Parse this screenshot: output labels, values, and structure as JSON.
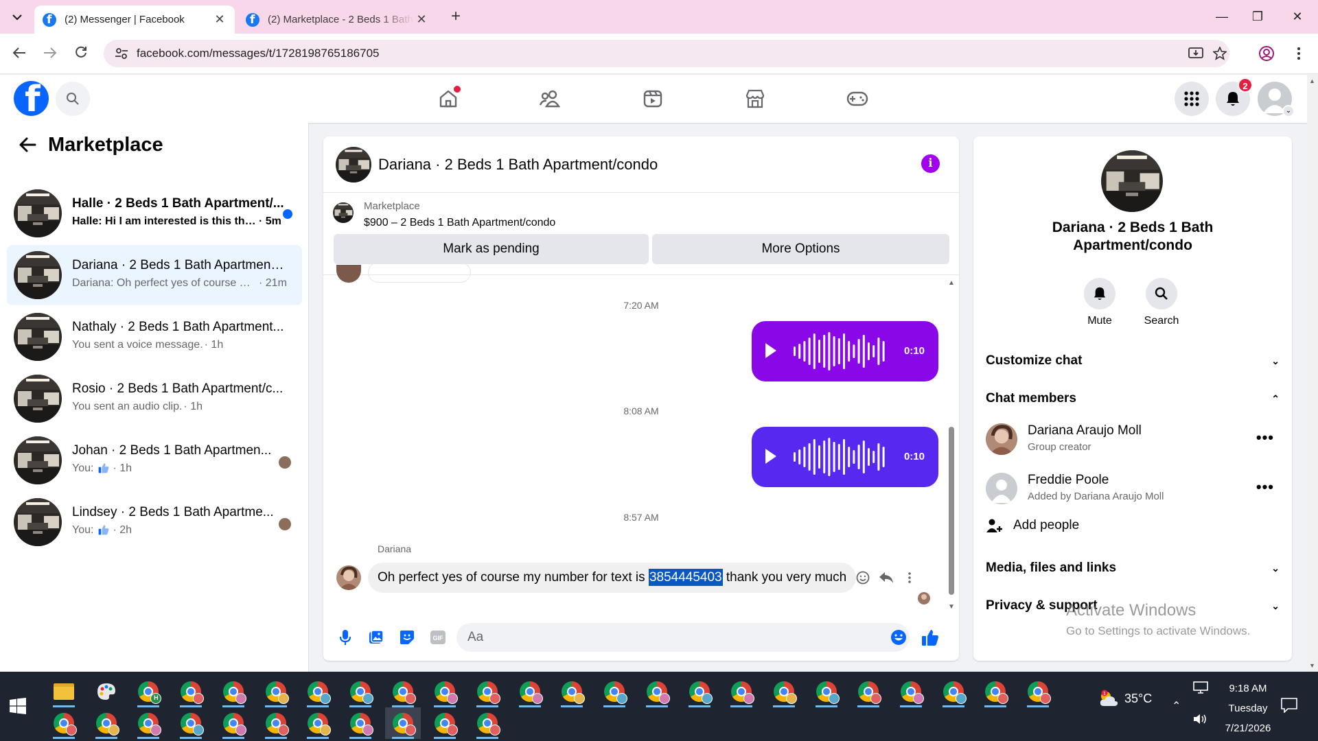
{
  "browser": {
    "tabs": [
      {
        "title": "(2) Messenger | Facebook",
        "active": true
      },
      {
        "title": "(2) Marketplace - 2 Beds 1 Bath",
        "active": false
      }
    ],
    "url": "facebook.com/messages/t/1728198765186705"
  },
  "fb": {
    "notification_count": "2"
  },
  "sidebar": {
    "title": "Marketplace",
    "conversations": [
      {
        "name": "Halle · 2 Beds 1 Bath Apartment/...",
        "snippet": "Halle: Hi I am interested is this the...",
        "time": "· 5m",
        "unread": true,
        "selected": false
      },
      {
        "name": "Dariana · 2 Beds 1 Bath Apartment...",
        "snippet": "Dariana: Oh perfect yes of course m...",
        "time": "· 21m",
        "unread": false,
        "selected": true
      },
      {
        "name": "Nathaly · 2 Beds 1 Bath Apartment...",
        "snippet": "You sent a voice message.",
        "time": "· 1h",
        "unread": false,
        "selected": false
      },
      {
        "name": "Rosio · 2 Beds 1 Bath Apartment/c...",
        "snippet": "You sent an audio clip.",
        "time": "· 1h",
        "unread": false,
        "selected": false
      },
      {
        "name": "Johan · 2 Beds 1 Bath Apartmen...",
        "snippet": "You:",
        "time": "· 1h",
        "unread": false,
        "selected": false,
        "like": true
      },
      {
        "name": "Lindsey · 2 Beds 1 Bath Apartme...",
        "snippet": "You:",
        "time": "· 2h",
        "unread": false,
        "selected": false,
        "like": true
      }
    ]
  },
  "chat": {
    "title": "Dariana · 2 Beds 1 Bath Apartment/condo",
    "listing_category": "Marketplace",
    "listing_price": "$900 – 2 Beds 1 Bath Apartment/condo",
    "mark_pending_label": "Mark as pending",
    "more_options_label": "More Options",
    "time_1": "7:20 AM",
    "time_2": "8:08 AM",
    "time_3": "8:57 AM",
    "voice_duration_1": "0:10",
    "voice_duration_2": "0:10",
    "voice_color_1": "#8a08e8",
    "voice_color_2": "#5628f0",
    "sender": "Dariana",
    "message_before": "Oh perfect yes of course my number for text is ",
    "message_highlight": "3854445403",
    "message_after": " thank you very much",
    "composer_placeholder": "Aa"
  },
  "info": {
    "name": "Dariana · 2 Beds 1 Bath Apartment/condo",
    "mute_label": "Mute",
    "search_label": "Search",
    "customize_chat": "Customize chat",
    "chat_members": "Chat members",
    "members": [
      {
        "name": "Dariana Araujo Moll",
        "sub": "Group creator"
      },
      {
        "name": "Freddie Poole",
        "sub": "Added by Dariana Araujo Moll"
      }
    ],
    "add_people": "Add people",
    "media_files_links": "Media, files and links",
    "privacy_support": "Privacy & support"
  },
  "watermark": {
    "line1": "Activate Windows",
    "line2": "Go to Settings to activate Windows."
  },
  "taskbar": {
    "temperature": "35°C",
    "time": "9:18 AM",
    "day": "Tuesday",
    "date": "7/21/2026"
  },
  "colors": {
    "fb_blue": "#0866ff",
    "selected_row": "#ebf5ff",
    "info_button": "#a100f2"
  }
}
